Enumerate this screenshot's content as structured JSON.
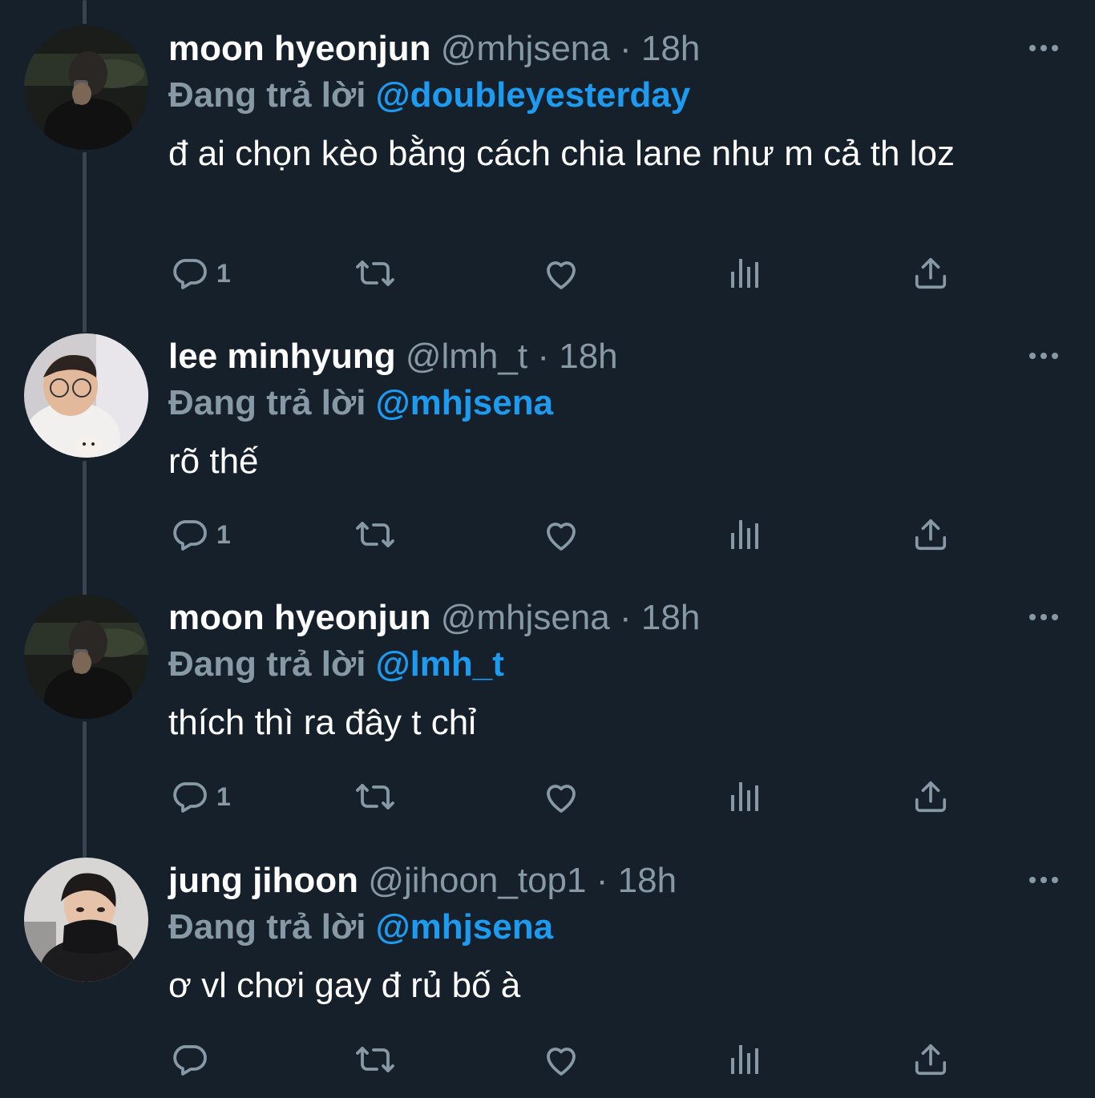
{
  "colors": {
    "background": "#15202b",
    "secondary_text": "#8899a6",
    "mention": "#1d9bf0",
    "thread_line": "#38444d"
  },
  "tweets": [
    {
      "name": "moon hyeonjun",
      "handle": "@mhjsena",
      "separator": "·",
      "time": "18h",
      "reply_prefix": "Đang trả lời",
      "reply_to": "@doubleyesterday",
      "text": "đ ai chọn kèo bằng cách chia lane như m cả th loz",
      "reply_count": "1",
      "avatar_icon": "avatar-photo"
    },
    {
      "name": "lee minhyung",
      "handle": "@lmh_t",
      "separator": "·",
      "time": "18h",
      "reply_prefix": "Đang trả lời",
      "reply_to": "@mhjsena",
      "text": "rõ thế",
      "reply_count": "1",
      "avatar_icon": "avatar-photo"
    },
    {
      "name": "moon hyeonjun",
      "handle": "@mhjsena",
      "separator": "·",
      "time": "18h",
      "reply_prefix": "Đang trả lời",
      "reply_to": "@lmh_t",
      "text": "thích thì ra đây t chỉ",
      "reply_count": "1",
      "avatar_icon": "avatar-photo"
    },
    {
      "name": "jung jihoon",
      "handle": "@jihoon_top1",
      "separator": "·",
      "time": "18h",
      "reply_prefix": "Đang trả lời",
      "reply_to": "@mhjsena",
      "text": "ơ vl chơi gay đ rủ bố à",
      "reply_count": "",
      "avatar_icon": "avatar-photo"
    }
  ],
  "action_icons": [
    "reply-icon",
    "retweet-icon",
    "like-icon",
    "views-icon",
    "share-icon"
  ]
}
